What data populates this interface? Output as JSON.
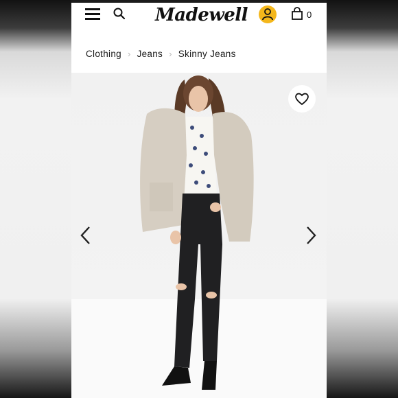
{
  "header": {
    "logo_text": "Madewell",
    "bag_count": "0",
    "accent_color": "#f4b71b"
  },
  "icons": [
    "menu-icon",
    "search-icon",
    "account-icon",
    "bag-icon",
    "heart-icon",
    "chevron-left-icon",
    "chevron-right-icon"
  ],
  "breadcrumb": {
    "items": [
      {
        "label": "Clothing"
      },
      {
        "label": "Jeans"
      },
      {
        "label": "Skinny Jeans"
      }
    ],
    "separator": "›"
  }
}
